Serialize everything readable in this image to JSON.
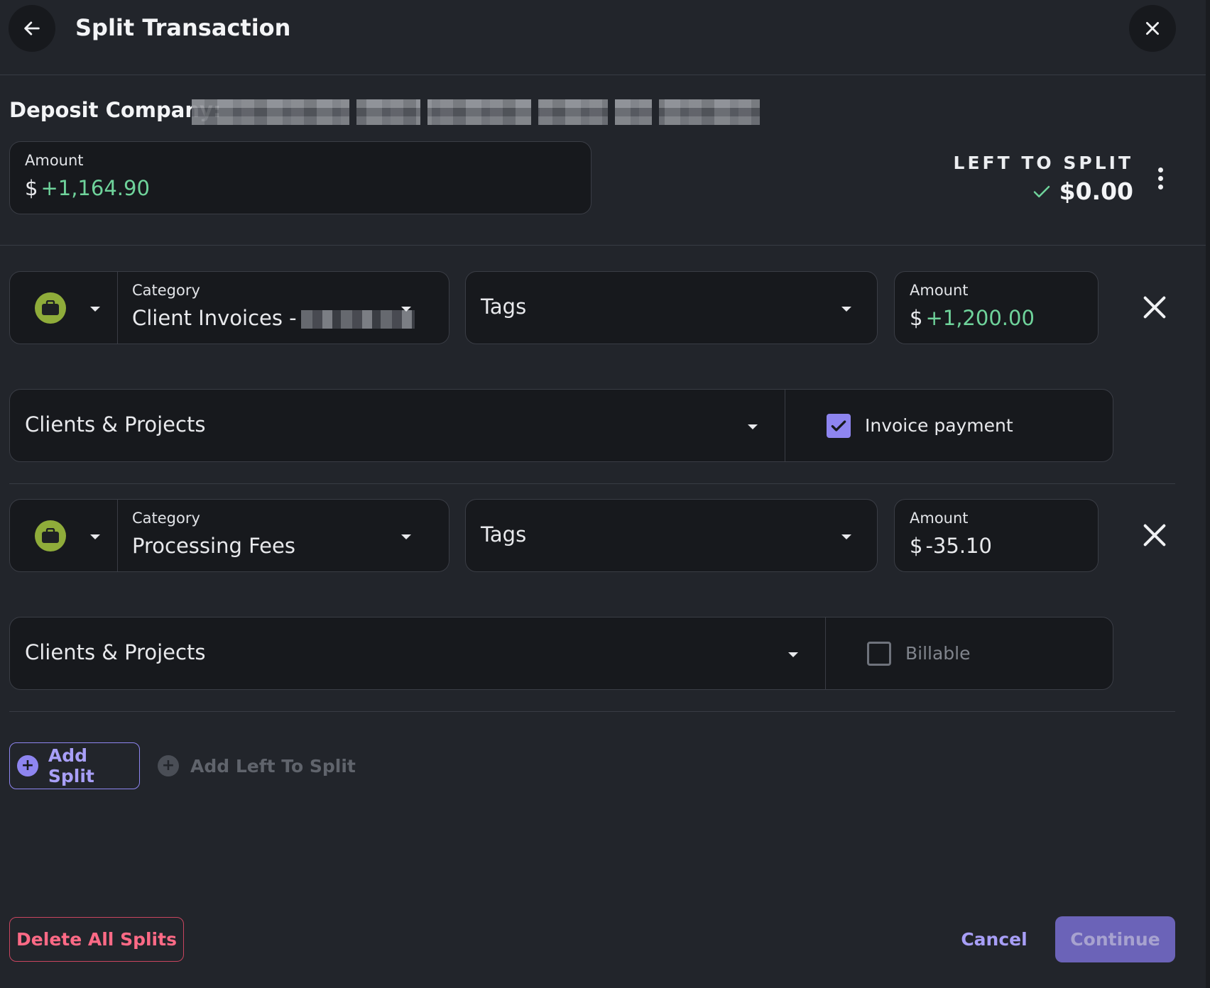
{
  "header": {
    "title": "Split Transaction",
    "back_icon": "arrow-left-icon",
    "close_icon": "close-icon"
  },
  "deposit": {
    "label": "Deposit Company:"
  },
  "total": {
    "label": "Amount",
    "currency": "$",
    "value": "+1,164.90"
  },
  "left_to_split": {
    "label": "LEFT TO SPLIT",
    "value": "$0.00",
    "check": "✓"
  },
  "splits": [
    {
      "category_label": "Category",
      "category_value": "Client Invoices -",
      "tags_placeholder": "Tags",
      "amount_label": "Amount",
      "amount_currency": "$",
      "amount_value": "+1,200.00",
      "clients_placeholder": "Clients & Projects",
      "checkbox_label": "Invoice payment",
      "checkbox_checked": true
    },
    {
      "category_label": "Category",
      "category_value": "Processing Fees",
      "tags_placeholder": "Tags",
      "amount_label": "Amount",
      "amount_currency": "$",
      "amount_value": "-35.10",
      "clients_placeholder": "Clients & Projects",
      "checkbox_label": "Billable",
      "checkbox_checked": false
    }
  ],
  "actions": {
    "add_split": "Add Split",
    "add_left_to_split": "Add Left To Split",
    "delete_all": "Delete All Splits",
    "cancel": "Cancel",
    "continue": "Continue"
  },
  "colors": {
    "background": "#22252b",
    "field": "#17191d",
    "accent": "#8e85f0",
    "positive": "#6fd39b",
    "danger": "#ff6a86",
    "category_badge": "#8fac3a"
  }
}
